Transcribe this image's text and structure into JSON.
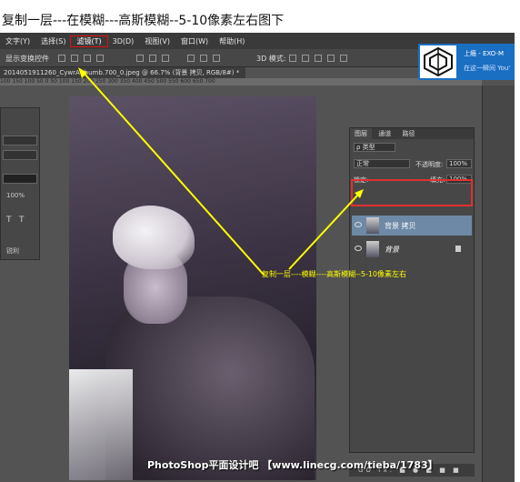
{
  "caption": "复制一层---在模糊---高斯模糊--5-10像素左右图下",
  "menu": [
    "文字(Y)",
    "选择(S)",
    "滤镜(T)",
    "3D(D)",
    "视图(V)",
    "窗口(W)",
    "帮助(H)"
  ],
  "options": {
    "transform_label": "显示变换控件",
    "mode_label": "3D 模式:"
  },
  "document_tab": "2014051911260_CywrA.thumb.700_0.jpeg @ 66.7% (背景 拷贝, RGB/8#) *",
  "ruler_text": "100   150   100    50     0     50    100   150   200   250   300   350   400   450   500   550   600   650   700",
  "left_panel": {
    "opacity": "100%",
    "t_label": "T",
    "lang_label": "锐利"
  },
  "layers_panel": {
    "tabs": [
      "图层",
      "通道",
      "路径"
    ],
    "filter_label": "ρ 类型",
    "blend_mode": "正常",
    "opacity_label": "不透明度:",
    "opacity_value": "100%",
    "lock_label": "锁定:",
    "fill_label": "填充:",
    "fill_value": "100%",
    "layers": [
      {
        "name": "背景 拷贝",
        "selected": true
      },
      {
        "name": "背景",
        "selected": false
      }
    ],
    "footer_icons": "GO fx. ■ ● ■ ■ ■"
  },
  "ad": {
    "title": "上瘾 - EXO-M",
    "subtitle": "在这一瞬间 You'"
  },
  "annotation": "复制一层----模糊----高斯模糊--5-10像素左右",
  "watermark": "PhotoShop平面设计吧 【www.linecg.com/tieba/1783】",
  "colors": {
    "arrow": "#ffff00",
    "highlight": "#e03030",
    "selected_layer": "#6d89a6"
  }
}
